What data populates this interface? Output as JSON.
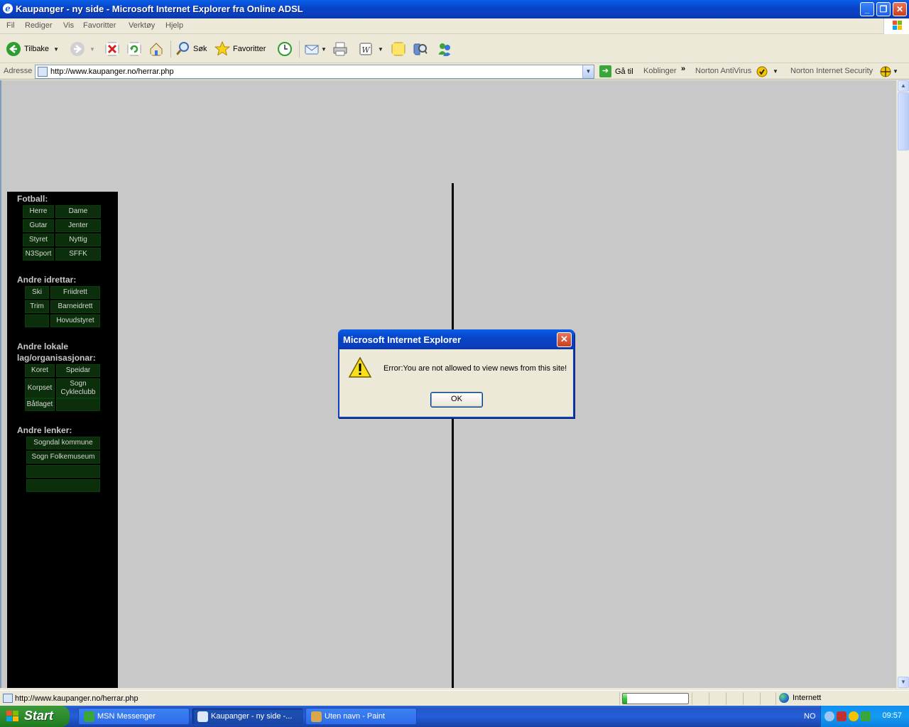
{
  "window": {
    "title": "Kaupanger - ny side - Microsoft Internet Explorer fra Online ADSL",
    "minimize": "_",
    "restore": "❐",
    "close": "✕"
  },
  "menu": [
    "Fil",
    "Rediger",
    "Vis",
    "Favoritter",
    "Verktøy",
    "Hjelp"
  ],
  "toolbar": {
    "back": "Tilbake",
    "search": "Søk",
    "favorites": "Favoritter"
  },
  "address": {
    "label": "Adresse",
    "url": "http://www.kaupanger.no/herrar.php",
    "go": "Gå til",
    "links": "Koblinger",
    "links_more": "»",
    "antivirus": "Norton AntiVirus",
    "internet_security": "Norton Internet Security"
  },
  "sidebar": {
    "fotball": {
      "heading": "Fotball:",
      "items": [
        "Herre",
        "Dame",
        "Gutar",
        "Jenter",
        "Styret",
        "Nyttig",
        "N3Sport",
        "SFFK"
      ]
    },
    "idrettar": {
      "heading": "Andre idrettar:",
      "items": [
        "Ski",
        "Friidrett",
        "Trim",
        "Barneidrett",
        "",
        "Hovudstyret"
      ]
    },
    "lokale": {
      "heading_line1": "Andre lokale",
      "heading_line2": "lag/organisasjonar:",
      "items": [
        "Koret",
        "Speidar",
        "Korpset",
        "Sogn Cykleclubb",
        "Båtlaget",
        ""
      ]
    },
    "lenker": {
      "heading": "Andre lenker:",
      "items": [
        "Sogndal kommune",
        "Sogn Folkemuseum",
        "",
        ""
      ]
    }
  },
  "dialog": {
    "title": "Microsoft Internet Explorer",
    "message": "Error:You are not allowed to view news from this site!",
    "ok": "OK",
    "close": "✕"
  },
  "status": {
    "text": "http://www.kaupanger.no/herrar.php",
    "progress": 0.06,
    "zone": "Internett"
  },
  "taskbar": {
    "start": "Start",
    "tasks": [
      "MSN Messenger",
      "Kaupanger - ny side -...",
      "Uten navn - Paint"
    ],
    "language": "NO",
    "clock": "09:57"
  },
  "colors": {
    "sidebar_bg": "#000000",
    "nav_button_bg": "#0b2e0b",
    "page_bg": "#c8c8c8",
    "titlebar_blue": "#0a46cc"
  }
}
